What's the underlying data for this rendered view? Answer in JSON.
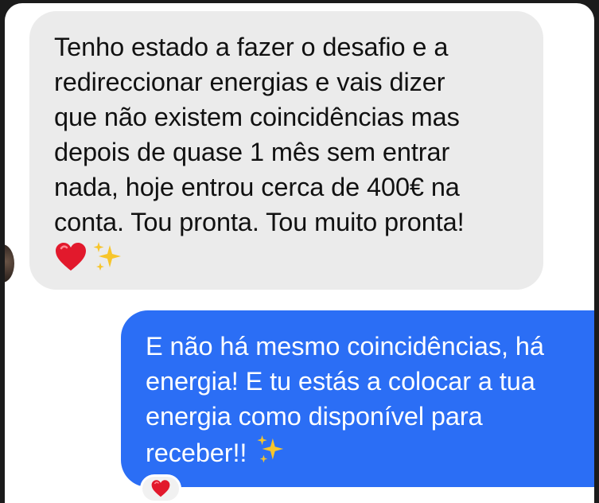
{
  "incoming_message": {
    "lines": [
      "Tenho estado a fazer o desafio e a",
      "redireccionar energias e vais dizer",
      "que não existem coincidências mas",
      "depois de quase 1 mês sem entrar",
      "nada, hoje entrou cerca de 400€ na",
      "conta. Tou pronta. Tou muito pronta!"
    ],
    "emojis": [
      "red-heart-emoji",
      "sparkles-emoji"
    ]
  },
  "outgoing_message": {
    "lines": [
      "E não há mesmo coincidências, há",
      "energia! E tu estás a colocar a tua",
      "energia como disponível para",
      "receber!!"
    ],
    "trailing_emoji": "sparkles-emoji"
  },
  "reaction": {
    "emoji": "red-heart-emoji"
  },
  "colors": {
    "incoming_bubble": "#ebebeb",
    "outgoing_bubble": "#2b6ef5",
    "incoming_text": "#111111",
    "outgoing_text": "#ffffff",
    "heart": "#e2192c",
    "sparkles": "#f7c52b"
  }
}
